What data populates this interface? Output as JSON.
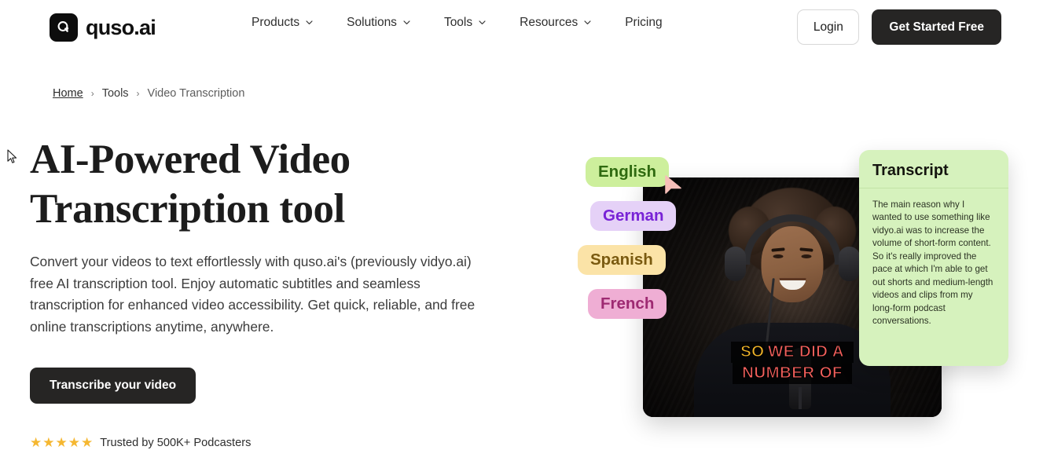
{
  "header": {
    "brand_name": "quso.ai",
    "logo_icon": "quso-q-logo-icon",
    "nav": [
      {
        "label": "Products",
        "has_dropdown": true
      },
      {
        "label": "Solutions",
        "has_dropdown": true
      },
      {
        "label": "Tools",
        "has_dropdown": true
      },
      {
        "label": "Resources",
        "has_dropdown": true
      },
      {
        "label": "Pricing",
        "has_dropdown": false
      }
    ],
    "login_label": "Login",
    "get_started_label": "Get Started Free"
  },
  "breadcrumb": {
    "home": "Home",
    "tools": "Tools",
    "current": "Video Transcription",
    "separator": "›"
  },
  "hero": {
    "title": "AI-Powered Video Transcription tool",
    "subtitle": "Convert your videos to text effortlessly with quso.ai's (previously vidyo.ai) free AI transcription tool. Enjoy automatic subtitles and seamless transcription for enhanced video accessibility. Get quick, reliable, and free online transcriptions anytime, anywhere.",
    "cta_label": "Transcribe your video",
    "trust_text": "Trusted by 500K+ Podcasters",
    "star_glyph": "★",
    "star_count": 5,
    "star_color": "#f5b731"
  },
  "visual": {
    "language_pills": [
      {
        "label": "English",
        "bg": "#cdef9c",
        "fg": "#2f6a10"
      },
      {
        "label": "German",
        "bg": "#e5d1f7",
        "fg": "#7822d6"
      },
      {
        "label": "Spanish",
        "bg": "#fbe3a7",
        "fg": "#7a5a10"
      },
      {
        "label": "French",
        "bg": "#efaed4",
        "fg": "#9e2a72"
      }
    ],
    "pointer_icon": "pink-arrow-cursor-icon",
    "video": {
      "subtitle_line1_word1": "SO",
      "subtitle_line1_rest": "WE DID A",
      "subtitle_line2": "NUMBER OF",
      "subtitle_highlight_color": "#f0b429",
      "subtitle_color": "#f4605c",
      "alt": "podcaster-with-headphones-and-microphone"
    },
    "transcript": {
      "title": "Transcript",
      "body": "The main reason why I wanted to use something like vidyo.ai was to increase the volume of short-form content. So it's really improved the pace at which I'm able to get out shorts and medium-length videos and clips from my long-form podcast conversations.",
      "bg": "#d6f2bd"
    }
  },
  "cursor": {
    "icon": "mouse-pointer-icon"
  }
}
